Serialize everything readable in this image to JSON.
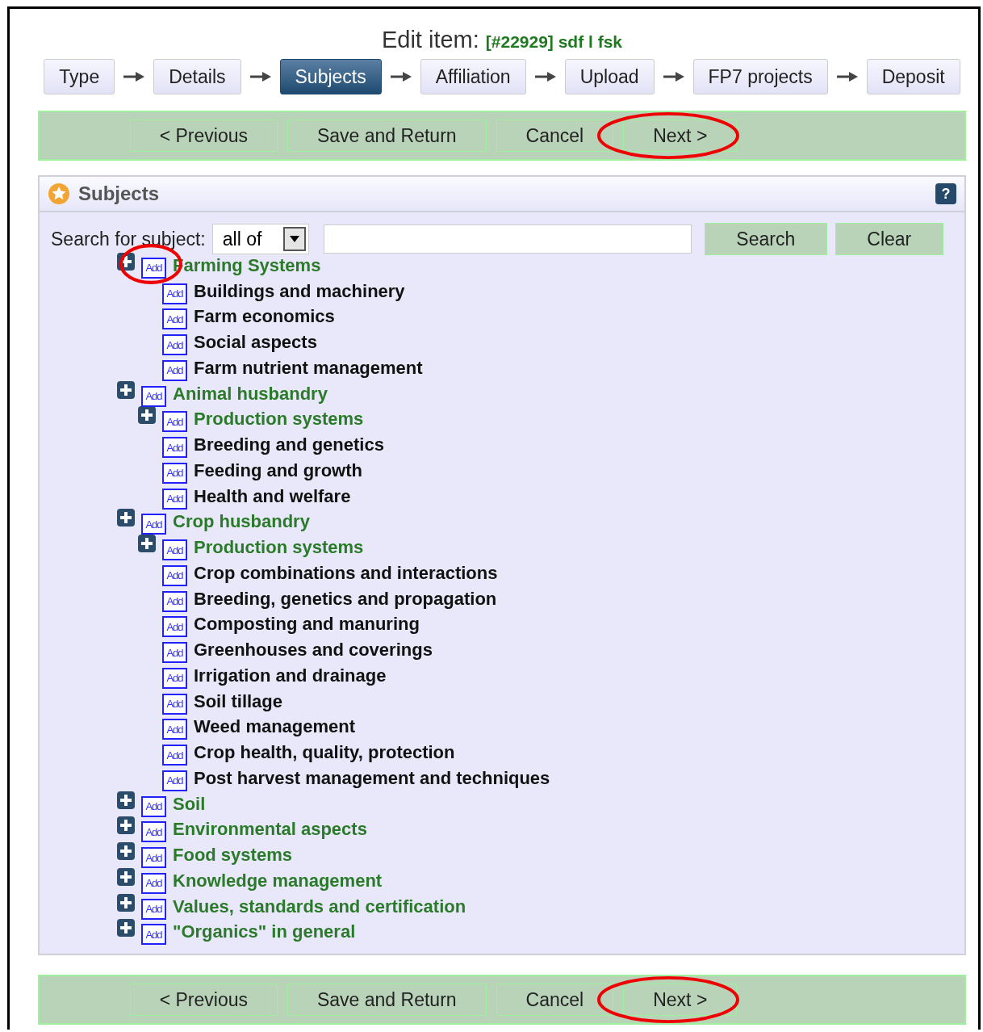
{
  "header": {
    "title": "Edit item:",
    "item_ref": "[#22929] sdf l fsk"
  },
  "steps": [
    {
      "label": "Type",
      "selected": false
    },
    {
      "label": "Details",
      "selected": false
    },
    {
      "label": "Subjects",
      "selected": true
    },
    {
      "label": "Affiliation",
      "selected": false
    },
    {
      "label": "Upload",
      "selected": false
    },
    {
      "label": "FP7 projects",
      "selected": false
    },
    {
      "label": "Deposit",
      "selected": false
    }
  ],
  "top_actions": [
    {
      "label": "< Previous"
    },
    {
      "label": "Save and Return"
    },
    {
      "label": "Cancel"
    },
    {
      "label": "Next >",
      "circled": true
    }
  ],
  "panel": {
    "title": "Subjects",
    "help": "?",
    "search": {
      "label": "Search for subject:",
      "mode": "all of",
      "buttons": [
        "Search",
        "Clear"
      ]
    },
    "tree": [
      {
        "label": "Farming Systems",
        "kind": "branch",
        "add": "Add",
        "circled": true,
        "children": [
          {
            "label": "Buildings and machinery",
            "kind": "leaf",
            "add": "Add"
          },
          {
            "label": "Farm economics",
            "kind": "leaf",
            "add": "Add"
          },
          {
            "label": "Social aspects",
            "kind": "leaf",
            "add": "Add"
          },
          {
            "label": "Farm nutrient management",
            "kind": "leaf",
            "add": "Add"
          }
        ]
      },
      {
        "label": "Animal husbandry",
        "kind": "branch",
        "add": "Add",
        "children": [
          {
            "label": "Production systems",
            "kind": "branch",
            "add": "Add"
          },
          {
            "label": "Breeding and genetics",
            "kind": "leaf",
            "add": "Add"
          },
          {
            "label": "Feeding and growth",
            "kind": "leaf",
            "add": "Add"
          },
          {
            "label": "Health and welfare",
            "kind": "leaf",
            "add": "Add"
          }
        ]
      },
      {
        "label": "Crop husbandry",
        "kind": "branch",
        "add": "Add",
        "children": [
          {
            "label": "Production systems",
            "kind": "branch",
            "add": "Add"
          },
          {
            "label": "Crop combinations and interactions",
            "kind": "leaf",
            "add": "Add"
          },
          {
            "label": "Breeding, genetics and propagation",
            "kind": "leaf",
            "add": "Add"
          },
          {
            "label": "Composting and manuring",
            "kind": "leaf",
            "add": "Add"
          },
          {
            "label": "Greenhouses and coverings",
            "kind": "leaf",
            "add": "Add"
          },
          {
            "label": "Irrigation and drainage",
            "kind": "leaf",
            "add": "Add"
          },
          {
            "label": "Soil tillage",
            "kind": "leaf",
            "add": "Add"
          },
          {
            "label": "Weed management",
            "kind": "leaf",
            "add": "Add"
          },
          {
            "label": "Crop health, quality, protection",
            "kind": "leaf",
            "add": "Add"
          },
          {
            "label": "Post harvest management and techniques",
            "kind": "leaf",
            "add": "Add"
          }
        ]
      },
      {
        "label": "Soil",
        "kind": "branch",
        "add": "Add"
      },
      {
        "label": "Environmental aspects",
        "kind": "branch",
        "add": "Add"
      },
      {
        "label": "Food systems",
        "kind": "branch",
        "add": "Add"
      },
      {
        "label": "Knowledge management",
        "kind": "branch",
        "add": "Add"
      },
      {
        "label": "Values, standards and certification",
        "kind": "branch",
        "add": "Add"
      },
      {
        "label": "\"Organics\" in general",
        "kind": "branch",
        "add": "Add"
      }
    ]
  },
  "bottom_actions": [
    {
      "label": "< Previous"
    },
    {
      "label": "Save and Return"
    },
    {
      "label": "Cancel"
    },
    {
      "label": "Next >",
      "circled": true
    }
  ]
}
